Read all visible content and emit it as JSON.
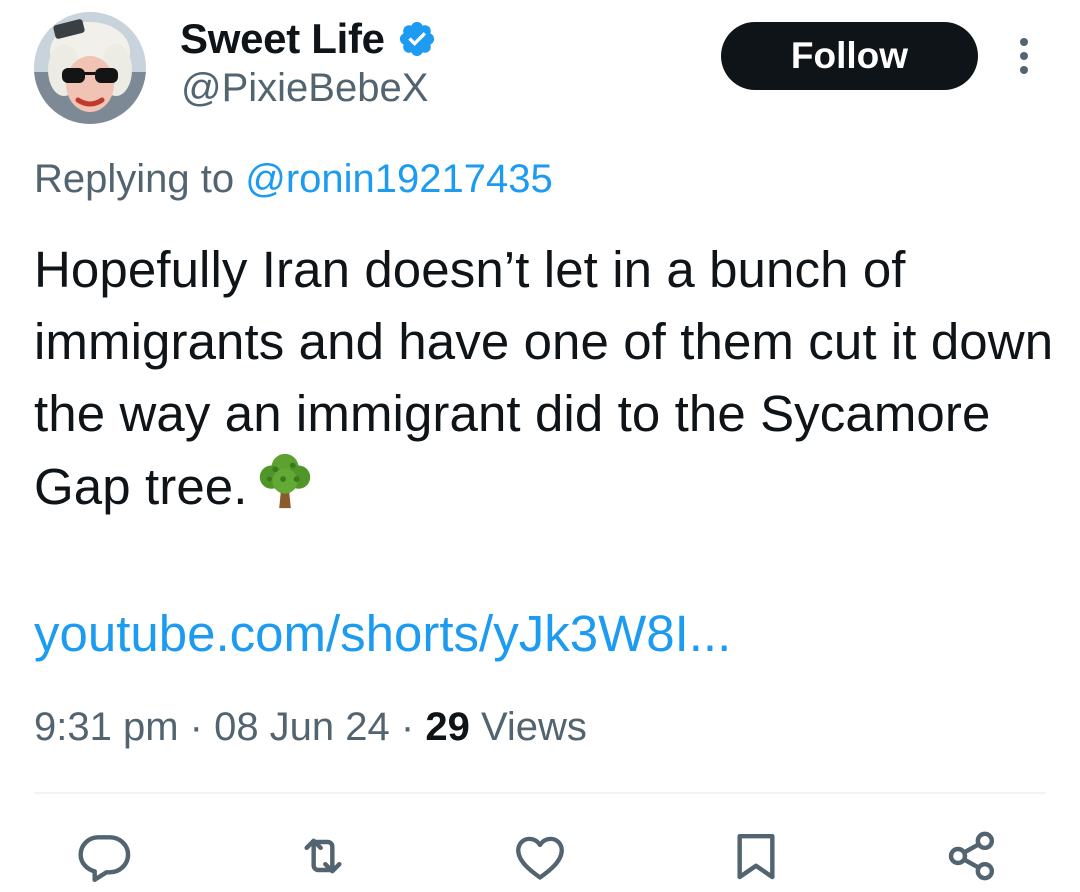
{
  "user": {
    "display_name": "Sweet Life",
    "handle": "@PixieBebeX",
    "verified": true
  },
  "follow_label": "Follow",
  "reply_to": {
    "prefix": "Replying to ",
    "mention": "@ronin19217435"
  },
  "tweet": {
    "text": "Hopefully Iran doesn’t let in a bunch of immigrants and have one of them cut it down the way an immigrant did to the Sycamore Gap tree.",
    "emoji": "deciduous-tree",
    "link": "youtube.com/shorts/yJk3W8I..."
  },
  "meta": {
    "time": "9:31 pm",
    "separator": " · ",
    "date": "08 Jun 24",
    "views_count": "29",
    "views_label": " Views"
  },
  "actions": [
    "reply-icon",
    "retweet-icon",
    "like-icon",
    "bookmark-icon",
    "share-icon"
  ],
  "colors": {
    "text": "#0f1419",
    "secondary": "#536471",
    "link": "#1d9bf0",
    "verified": "#1d9bf0",
    "button_bg": "#0f1419"
  }
}
